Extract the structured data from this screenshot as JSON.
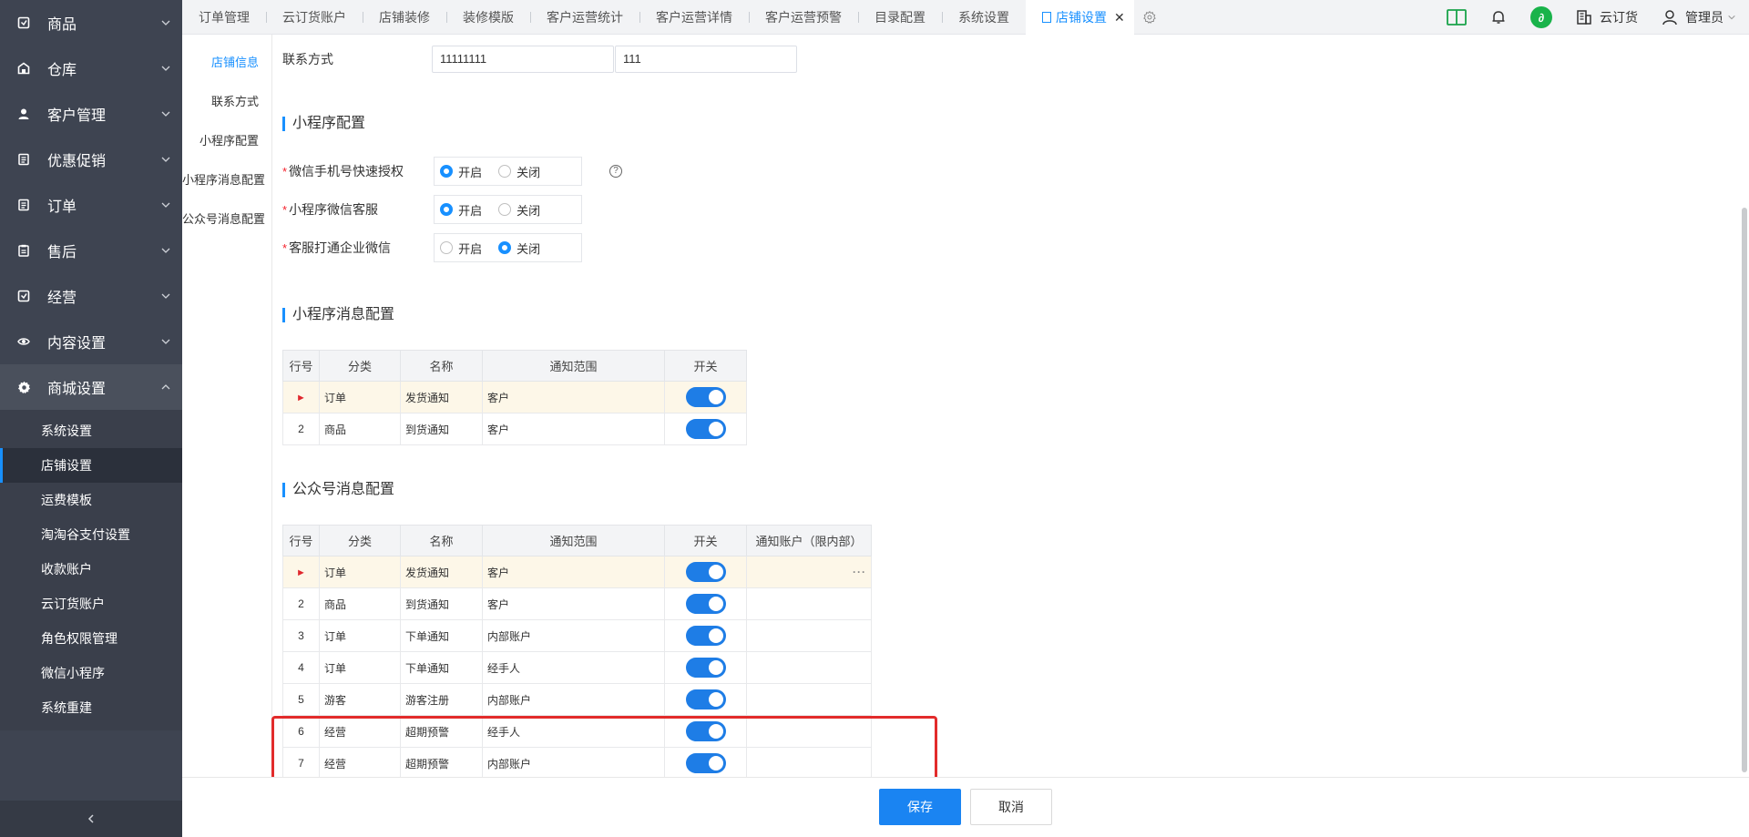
{
  "sidebar": {
    "menu": [
      {
        "label": "商品",
        "icon": "box-icon"
      },
      {
        "label": "仓库",
        "icon": "warehouse-icon"
      },
      {
        "label": "客户管理",
        "icon": "user-icon"
      },
      {
        "label": "优惠促销",
        "icon": "list-icon"
      },
      {
        "label": "订单",
        "icon": "list-icon"
      },
      {
        "label": "售后",
        "icon": "clipboard-icon"
      },
      {
        "label": "经营",
        "icon": "box-icon"
      },
      {
        "label": "内容设置",
        "icon": "eye-icon"
      },
      {
        "label": "商城设置",
        "icon": "gear-icon"
      }
    ],
    "submenu": [
      "系统设置",
      "店铺设置",
      "运费模板",
      "淘淘谷支付设置",
      "收款账户",
      "云订货账户",
      "角色权限管理",
      "微信小程序",
      "系统重建"
    ],
    "active_sub": "店铺设置",
    "collapse_icon": "chevron-left-icon"
  },
  "tabs": [
    {
      "label": "订单管理"
    },
    {
      "label": "云订货账户"
    },
    {
      "label": "店铺装修"
    },
    {
      "label": "装修模版"
    },
    {
      "label": "客户运营统计"
    },
    {
      "label": "客户运营详情"
    },
    {
      "label": "客户运营预警"
    },
    {
      "label": "目录配置"
    },
    {
      "label": "系统设置"
    },
    {
      "label": "店铺设置",
      "active": true
    }
  ],
  "topright": {
    "company": "云订货",
    "user": "管理员"
  },
  "anchors": [
    "店铺信息",
    "联系方式",
    "小程序配置",
    "小程序消息配置",
    "公众号消息配置"
  ],
  "contact": {
    "label": "联系方式",
    "phone": "11111111",
    "ext": "111"
  },
  "miniapp_config": {
    "title": "小程序配置",
    "rows": [
      {
        "label": "微信手机号快速授权",
        "on_label": "开启",
        "off_label": "关闭",
        "value": "开启",
        "help": "?"
      },
      {
        "label": "小程序微信客服",
        "on_label": "开启",
        "off_label": "关闭",
        "value": "开启"
      },
      {
        "label": "客服打通企业微信",
        "on_label": "开启",
        "off_label": "关闭",
        "value": "关闭"
      }
    ]
  },
  "miniapp_msg": {
    "title": "小程序消息配置",
    "headers": [
      "行号",
      "分类",
      "名称",
      "通知范围",
      "开关"
    ],
    "rows": [
      {
        "no": "►",
        "cat": "订单",
        "name": "发货通知",
        "scope": "客户",
        "on": true
      },
      {
        "no": "2",
        "cat": "商品",
        "name": "到货通知",
        "scope": "客户",
        "on": true
      }
    ]
  },
  "mp_msg": {
    "title": "公众号消息配置",
    "headers": [
      "行号",
      "分类",
      "名称",
      "通知范围",
      "开关",
      "通知账户（限内部）"
    ],
    "rows": [
      {
        "no": "►",
        "cat": "订单",
        "name": "发货通知",
        "scope": "客户",
        "on": true,
        "account": "···"
      },
      {
        "no": "2",
        "cat": "商品",
        "name": "到货通知",
        "scope": "客户",
        "on": true,
        "account": ""
      },
      {
        "no": "3",
        "cat": "订单",
        "name": "下单通知",
        "scope": "内部账户",
        "on": true,
        "account": ""
      },
      {
        "no": "4",
        "cat": "订单",
        "name": "下单通知",
        "scope": "经手人",
        "on": true,
        "account": ""
      },
      {
        "no": "5",
        "cat": "游客",
        "name": "游客注册",
        "scope": "内部账户",
        "on": true,
        "account": ""
      },
      {
        "no": "6",
        "cat": "经营",
        "name": "超期预警",
        "scope": "经手人",
        "on": true,
        "account": ""
      },
      {
        "no": "7",
        "cat": "经营",
        "name": "超期预警",
        "scope": "内部账户",
        "on": true,
        "account": ""
      }
    ]
  },
  "footer": {
    "save": "保存",
    "cancel": "取消"
  },
  "colors": {
    "accent": "#1890ff",
    "sidebar": "#3e4451",
    "highlight": "#e22b2b",
    "toggle_on": "#1e7de6"
  }
}
